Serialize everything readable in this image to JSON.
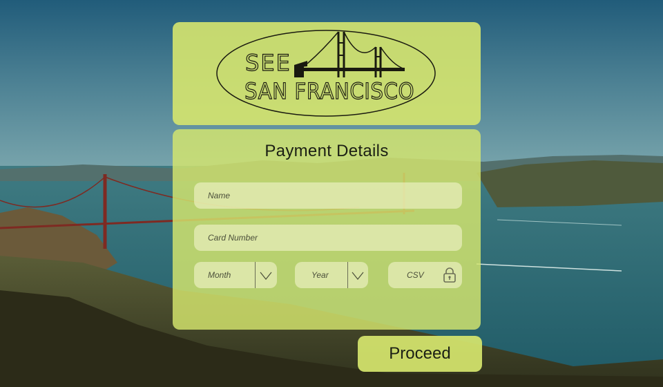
{
  "brand": {
    "logo_line1": "SEE",
    "logo_line2": "SAN FRANCISCO"
  },
  "form": {
    "title": "Payment Details",
    "name_placeholder": "Name",
    "card_placeholder": "Card Number",
    "month_placeholder": "Month",
    "year_placeholder": "Year",
    "csv_placeholder": "CSV"
  },
  "actions": {
    "proceed_label": "Proceed"
  },
  "icons": {
    "month": "chevron-down-icon",
    "year": "chevron-down-icon",
    "csv": "lock-icon"
  },
  "colors": {
    "panel": "#d6e66e",
    "field": "#eef1c4",
    "text": "#1b1f14"
  }
}
